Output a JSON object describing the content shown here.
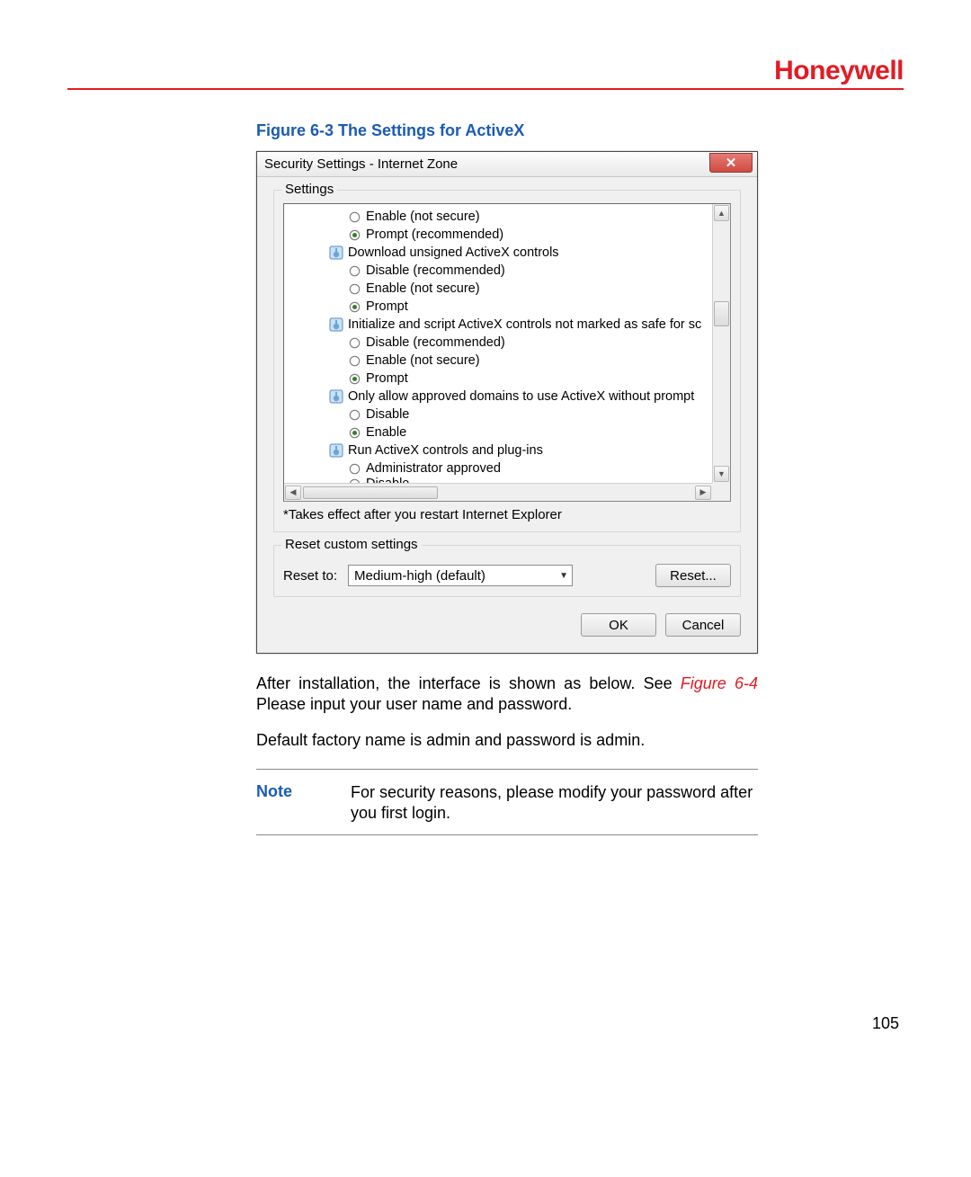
{
  "header": {
    "brand": "Honeywell"
  },
  "figure": {
    "caption": "Figure 6-3 The Settings for ActiveX"
  },
  "dialog": {
    "title": "Security Settings - Internet Zone",
    "close_glyph": "✕",
    "settings_group_label": "Settings",
    "tree": [
      {
        "kind": "option",
        "label": "Enable (not secure)",
        "selected": false
      },
      {
        "kind": "option",
        "label": "Prompt (recommended)",
        "selected": true
      },
      {
        "kind": "category",
        "label": "Download unsigned ActiveX controls"
      },
      {
        "kind": "option",
        "label": "Disable (recommended)",
        "selected": false
      },
      {
        "kind": "option",
        "label": "Enable (not secure)",
        "selected": false
      },
      {
        "kind": "option",
        "label": "Prompt",
        "selected": true
      },
      {
        "kind": "category",
        "label": "Initialize and script ActiveX controls not marked as safe for sc"
      },
      {
        "kind": "option",
        "label": "Disable (recommended)",
        "selected": false
      },
      {
        "kind": "option",
        "label": "Enable (not secure)",
        "selected": false
      },
      {
        "kind": "option",
        "label": "Prompt",
        "selected": true
      },
      {
        "kind": "category",
        "label": "Only allow approved domains to use ActiveX without prompt"
      },
      {
        "kind": "option",
        "label": "Disable",
        "selected": false
      },
      {
        "kind": "option",
        "label": "Enable",
        "selected": true
      },
      {
        "kind": "category",
        "label": "Run ActiveX controls and plug-ins"
      },
      {
        "kind": "option",
        "label": "Administrator approved",
        "selected": false
      },
      {
        "kind": "option",
        "label": "Disable",
        "selected": false,
        "partial": true
      }
    ],
    "footnote": "*Takes effect after you restart Internet Explorer",
    "reset_group_label": "Reset custom settings",
    "reset_to_label": "Reset to:",
    "reset_combo_value": "Medium-high (default)",
    "reset_button": "Reset...",
    "ok_button": "OK",
    "cancel_button": "Cancel"
  },
  "body": {
    "para1_a": "After installation, the interface is shown as below. See ",
    "para1_figref": "Figure 6-4",
    "para1_b": " Please input your user name and password.",
    "para2": "Default factory name is admin and password is admin."
  },
  "note": {
    "label": "Note",
    "text": "For security reasons, please modify your password after you first login."
  },
  "page_number": "105"
}
